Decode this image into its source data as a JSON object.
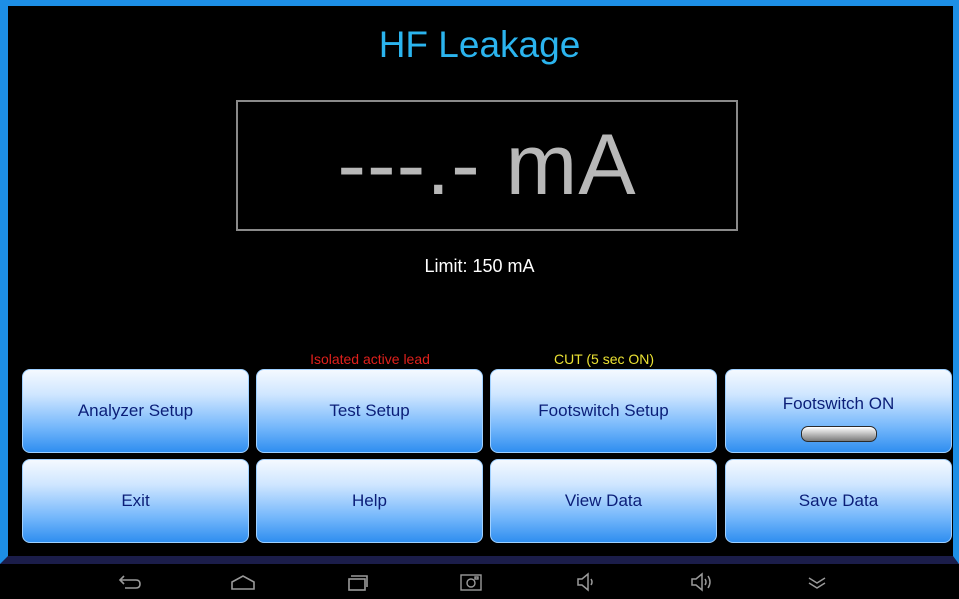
{
  "header": {
    "title": "HF Leakage"
  },
  "reading": {
    "value": "---.-",
    "unit": "mA"
  },
  "limit_text": "Limit: 150 mA",
  "status": {
    "lead_mode": "Isolated active lead",
    "cut_mode": "CUT (5 sec ON)"
  },
  "buttons": {
    "analyzer_setup": "Analyzer Setup",
    "test_setup": "Test Setup",
    "footswitch_setup": "Footswitch Setup",
    "footswitch": "Footswitch ON",
    "exit": "Exit",
    "help": "Help",
    "view_data": "View Data",
    "save_data": "Save Data"
  },
  "navbar": {
    "icons": [
      "back-icon",
      "home-icon",
      "recent-apps-icon",
      "screenshot-icon",
      "volume-down-icon",
      "volume-up-icon",
      "collapse-icon"
    ]
  },
  "colors": {
    "title": "#2bb4ee",
    "frame": "#1d8fe6",
    "lead_status": "#e0201c",
    "cut_status": "#ebe233",
    "button_text": "#0b1e78"
  }
}
